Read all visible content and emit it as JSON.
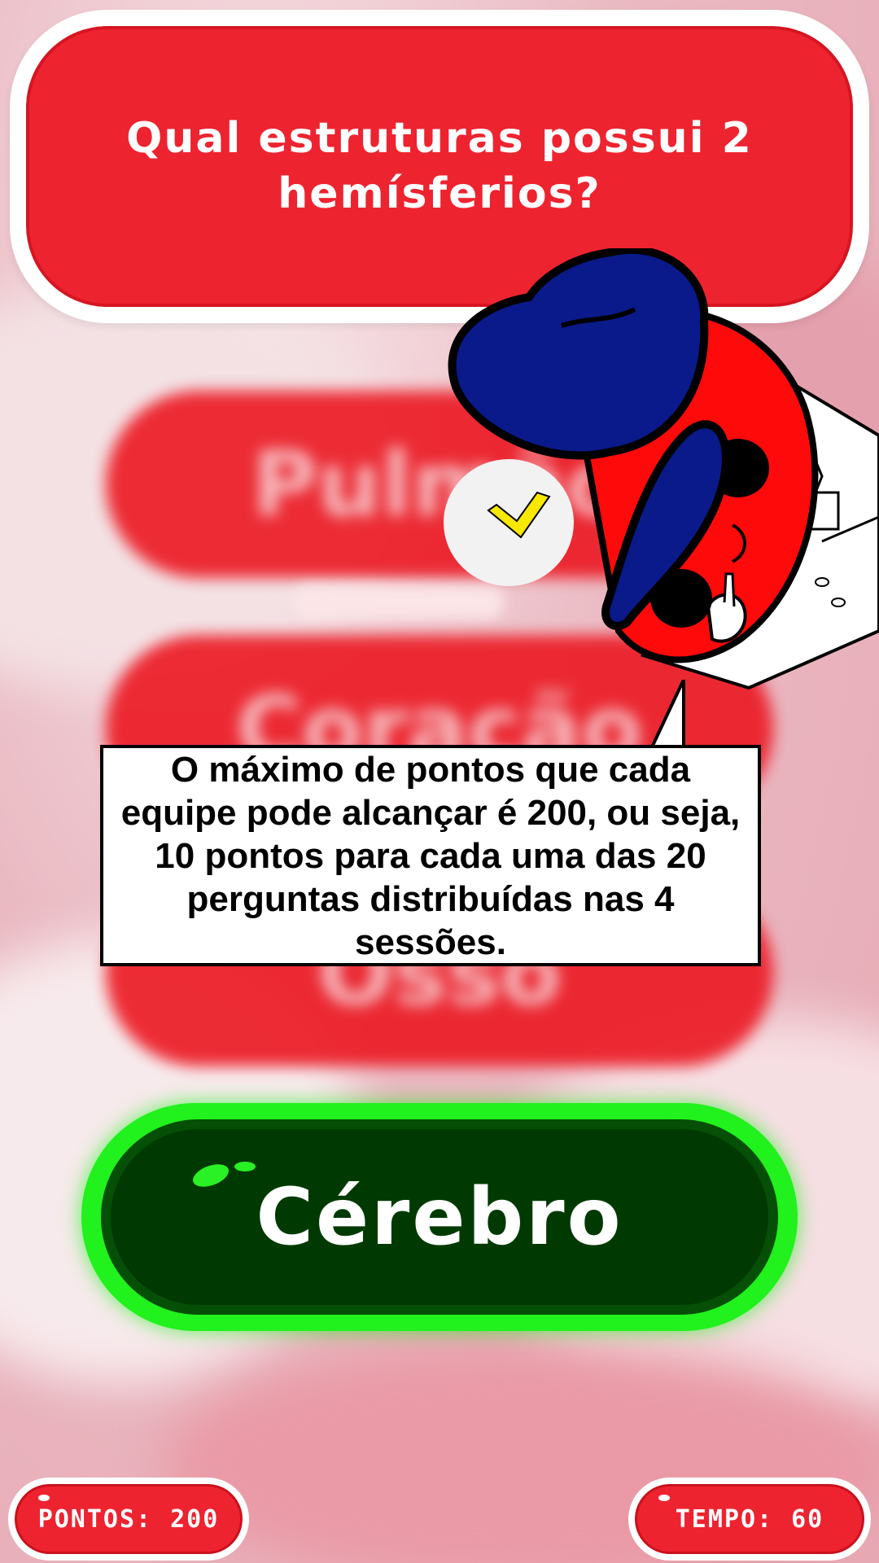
{
  "question": {
    "text": "Qual estruturas possui 2 hemísferios?"
  },
  "answers": [
    {
      "label": "Pulmão",
      "state": "blurred"
    },
    {
      "label": "Coração",
      "state": "blurred"
    },
    {
      "label": "Osso",
      "state": "blurred"
    }
  ],
  "correct_answer": {
    "label": "Cérebro"
  },
  "speech_bubble": {
    "text": "O máximo de pontos que cada equipe pode alcançar é 200, ou seja, 10 pontos para cada uma das 20 perguntas distribuídas nas 4 sessões."
  },
  "hud": {
    "points_label": "PONTOS:",
    "points_value": "200",
    "time_label": "TEMPO:",
    "time_value": "60"
  },
  "colors": {
    "question_red": "#ee2330",
    "correct_green": "#21f11d",
    "correct_dark": "#003a02",
    "mascot_cap": "#0a1a8a",
    "mascot_body": "#ff0a0a"
  }
}
